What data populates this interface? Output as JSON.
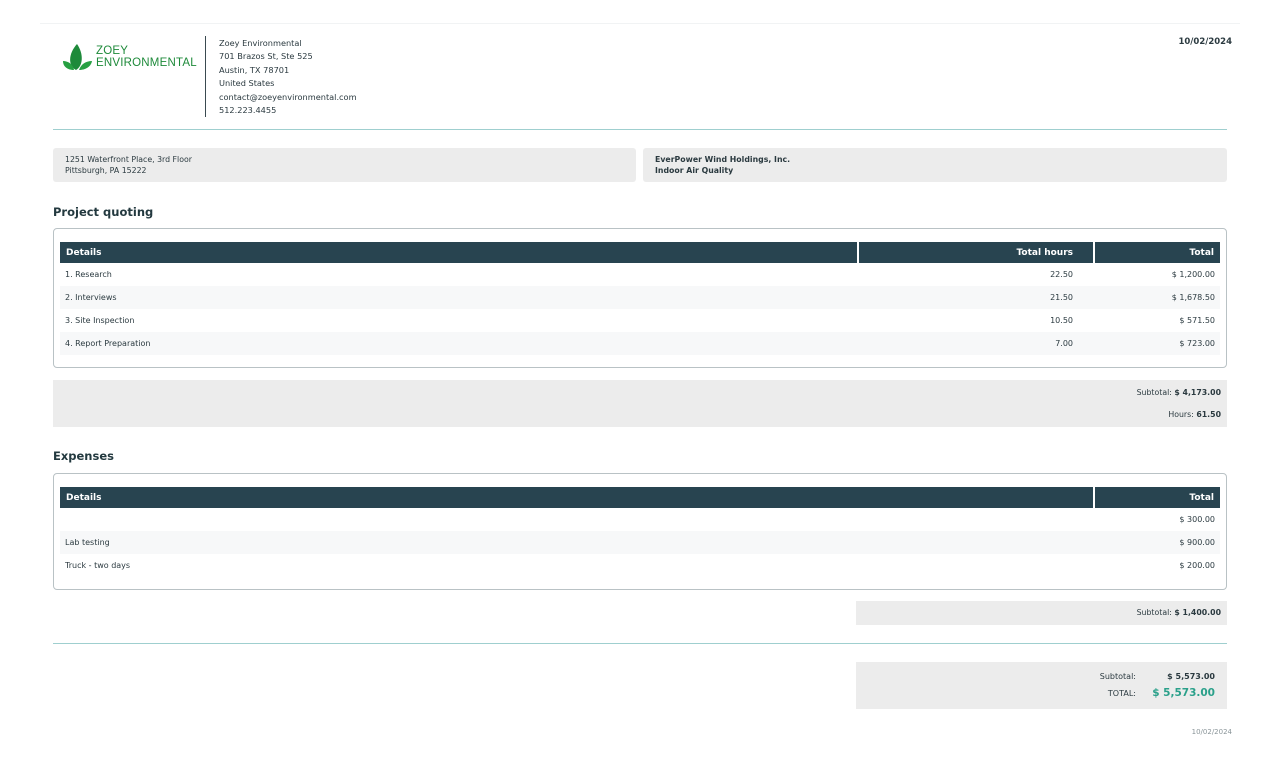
{
  "logo": {
    "line1": "ZOEY",
    "line2": "ENVIRONMENTAL",
    "brand_color": "#1e8a3a",
    "icon": "leaf-icon"
  },
  "company": {
    "name": "Zoey Environmental",
    "street": "701 Brazos St, Ste 525",
    "city": "Austin, TX 78701",
    "country": "United States",
    "email": "contact@zoeyenvironmental.com",
    "phone": "512.223.4455"
  },
  "document_date": "10/02/2024",
  "client_address": {
    "line1": "1251 Waterfront Place, 3rd Floor",
    "line2": "Pittsburgh, PA 15222"
  },
  "client": {
    "name": "EverPower Wind Holdings, Inc.",
    "project": "Indoor Air Quality"
  },
  "quoting": {
    "title": "Project quoting",
    "headers": {
      "details": "Details",
      "hours": "Total hours",
      "total": "Total"
    },
    "rows": [
      {
        "details": "1. Research",
        "hours": "22.50",
        "total": "$ 1,200.00"
      },
      {
        "details": "2. Interviews",
        "hours": "21.50",
        "total": "$ 1,678.50"
      },
      {
        "details": "3. Site Inspection",
        "hours": "10.50",
        "total": "$ 571.50"
      },
      {
        "details": "4. Report Preparation",
        "hours": "7.00",
        "total": "$ 723.00"
      }
    ],
    "subtotal_label": "Subtotal:",
    "subtotal": "$ 4,173.00",
    "hours_label": "Hours:",
    "hours_total": "61.50"
  },
  "expenses": {
    "title": "Expenses",
    "headers": {
      "details": "Details",
      "total": "Total"
    },
    "rows": [
      {
        "details": "",
        "total": "$ 300.00"
      },
      {
        "details": "Lab testing",
        "total": "$ 900.00"
      },
      {
        "details": "Truck - two days",
        "total": "$ 200.00"
      }
    ],
    "subtotal_label": "Subtotal:",
    "subtotal": "$ 1,400.00"
  },
  "totals": {
    "subtotal_label": "Subtotal:",
    "subtotal": "$ 5,573.00",
    "total_label": "TOTAL:",
    "total": "$ 5,573.00",
    "total_color": "#2aa08a"
  },
  "footer_date": "10/02/2024",
  "colors": {
    "table_header": "#284450",
    "divider": "#9fcfcf",
    "panel": "#ececec"
  }
}
